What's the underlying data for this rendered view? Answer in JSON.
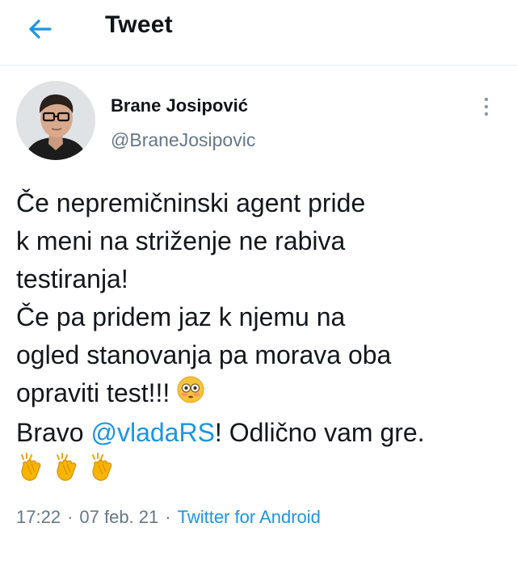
{
  "header": {
    "title": "Tweet",
    "back_icon": "arrow-left-icon"
  },
  "colors": {
    "accent": "#1b95e0",
    "secondary_text": "#657786",
    "divider": "#e6ecf0"
  },
  "tweet": {
    "author": {
      "name": "Brane Josipović",
      "handle": "@BraneJosipovic"
    },
    "lines": [
      "Če nepremičninski agent pride",
      "k meni na striženje ne rabiva",
      "testiranja!",
      "Če pa pridem jaz k njemu na",
      "ogled stanovanja pa morava oba",
      "opraviti test!!!"
    ],
    "last_line": {
      "prefix": "Bravo ",
      "mention": "@vladaRS",
      "suffix": "! Odlično vam gre."
    },
    "emojis": {
      "flushed": "flushed-face-emoji",
      "clap": "clapping-hands-emoji",
      "clap_count": 3
    },
    "time": "17:22",
    "date": "07 feb. 21",
    "separator": "·",
    "source": "Twitter for Android"
  }
}
